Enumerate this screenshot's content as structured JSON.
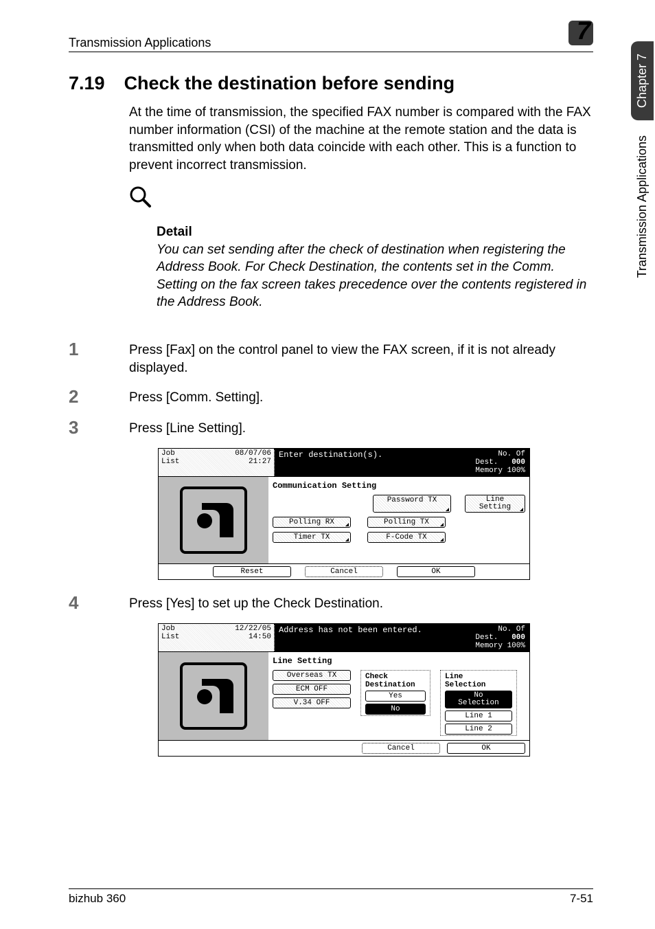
{
  "header": {
    "breadcrumb": "Transmission Applications",
    "chapter_num": "7"
  },
  "side_tab": {
    "dark": "Chapter 7",
    "light": "Transmission Applications"
  },
  "section": {
    "number": "7.19",
    "title": "Check the destination before sending"
  },
  "intro": "At the time of transmission, the specified FAX number is compared with the FAX number information (CSI) of the machine at the remote station and the data is transmitted only when both data coincide with each other. This is a function to prevent incorrect transmission.",
  "detail": {
    "heading": "Detail",
    "text": "You can set sending after the check of destination when registering the Address Book. For Check Destination, the contents set in the Comm. Setting on the fax screen takes precedence over the contents registered in the Address Book."
  },
  "steps": [
    "Press [Fax] on the control panel to view the FAX screen, if it is not already displayed.",
    "Press [Comm. Setting].",
    "Press [Line Setting].",
    "Press [Yes] to set up the Check Destination."
  ],
  "screen1": {
    "joblist_l1": "Job",
    "joblist_l2": "List",
    "joblist_date": "08/07/06",
    "joblist_time": "21:27",
    "top_msg": "Enter destination(s).",
    "dest_label": "No. Of\nDest.",
    "dest_count": "000",
    "memory": "Memory 100%",
    "section": "Communication Setting",
    "buttons": {
      "password_tx": "Password TX",
      "line_setting": "Line\nSetting",
      "polling_rx": "Polling RX",
      "polling_tx": "Polling TX",
      "timer_tx": "Timer TX",
      "fcode_tx": "F-Code TX"
    },
    "footer": {
      "reset": "Reset",
      "cancel": "Cancel",
      "ok": "OK"
    }
  },
  "screen2": {
    "joblist_l1": "Job",
    "joblist_l2": "List",
    "joblist_date": "12/22/05",
    "joblist_time": "14:50",
    "top_msg": "Address has not been entered.",
    "dest_label": "No. Of\nDest.",
    "dest_count": "000",
    "memory": "Memory 100%",
    "section": "Line Setting",
    "left_buttons": {
      "overseas": "Overseas TX",
      "ecm": "ECM OFF",
      "v34": "V.34 OFF"
    },
    "check_group": {
      "title": "Check\nDestination",
      "yes": "Yes",
      "no": "No"
    },
    "line_group": {
      "title": "Line\nSelection",
      "nosel": "No\nSelection",
      "line1": "Line 1",
      "line2": "Line 2"
    },
    "footer": {
      "cancel": "Cancel",
      "ok": "OK"
    }
  },
  "footer": {
    "left": "bizhub 360",
    "right": "7-51"
  }
}
